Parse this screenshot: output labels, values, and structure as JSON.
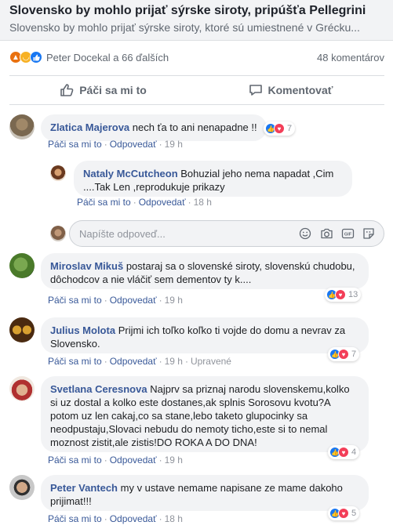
{
  "link_preview": {
    "title": "Slovensko by mohlo prijať sýrske siroty, pripúšťa Pellegrini",
    "description": "Slovensko by mohlo prijať sýrske siroty, ktoré sú umiestnené v Grécku..."
  },
  "post_summary": {
    "reactors_text": "Peter Docekal a 66 ďalších",
    "comments_count": "48 komentárov",
    "reaction_icons": [
      "angry-icon",
      "haha-icon",
      "like-icon"
    ]
  },
  "actions": {
    "like_label": "Páči sa mi to",
    "comment_label": "Komentovať"
  },
  "meta_labels": {
    "like": "Páči sa mi to",
    "reply": "Odpovedať",
    "separator": "·"
  },
  "comments": [
    {
      "author": "Zlatica Majerova",
      "text": "nech ťa to ani nenapadne !!",
      "time": "19 h",
      "reaction_count": "7"
    },
    {
      "author": "Nataly McCutcheon",
      "text": "Bohuzial jeho nema napadat ,Cim ....Tak Len ,reprodukuje prikazy",
      "time": "18 h"
    },
    {
      "author": "Miroslav Mikuš",
      "text": "postaraj sa o slovenské siroty, slovenskú chudobu, dôchodcov a nie vláčiť sem dementov ty k....",
      "time": "19 h",
      "reaction_count": "13"
    },
    {
      "author": "Julius Molota",
      "text": "Prijmi ich toľko koľko ti vojde do domu a nevrav za Slovensko.",
      "time": "19 h",
      "edited": "Upravené",
      "reaction_count": "7"
    },
    {
      "author": "Svetlana Ceresnova",
      "text": "Najprv sa priznaj narodu slovenskemu,kolko si uz dostal a kolko este dostanes,ak splnis Sorosovu kvotu?A potom uz len cakaj,co sa stane,lebo taketo glupocinky sa neodpustaju,Slovaci nebudu do nemoty ticho,este si to nemal moznost zistit,ale zistis!DO ROKA A DO DNA!",
      "time": "19 h",
      "reaction_count": "4"
    },
    {
      "author": "Peter Vantech",
      "text": "my v ustave nemame napisane ze mame dakoho prijimat!!!",
      "time": "18 h",
      "reaction_count": "5"
    }
  ],
  "reply_input": {
    "placeholder": "Napíšte odpoveď..."
  },
  "colors": {
    "link": "#385898",
    "bubble": "#f2f3f5",
    "like_blue": "#1877f2",
    "love_red": "#f33e58",
    "angry_orange": "#e9710f",
    "haha_yellow": "#f7b125"
  }
}
